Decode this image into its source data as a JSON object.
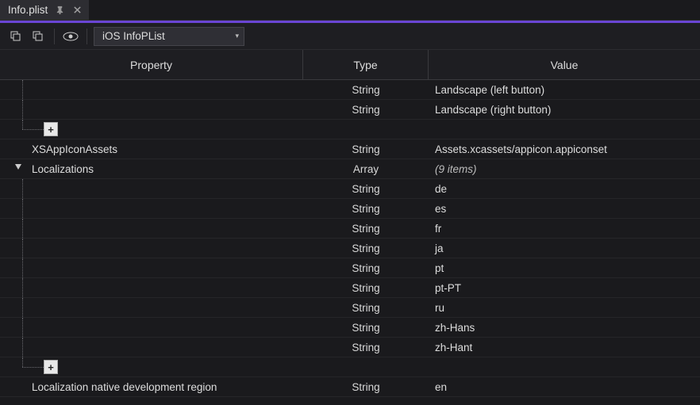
{
  "tab": {
    "title": "Info.plist"
  },
  "toolbar": {
    "dropdown": "iOS InfoPList"
  },
  "columns": {
    "property": "Property",
    "type": "Type",
    "value": "Value"
  },
  "rows": [
    {
      "indent": 1,
      "guide": "through",
      "prop": "",
      "type": "String",
      "value": "Landscape (left button)"
    },
    {
      "indent": 1,
      "guide": "through",
      "prop": "",
      "type": "String",
      "value": "Landscape (right button)"
    },
    {
      "indent": 1,
      "guide": "end-add",
      "prop": "",
      "type": "",
      "value": ""
    },
    {
      "indent": 0,
      "guide": "none",
      "prop": "XSAppIconAssets",
      "type": "String",
      "value": "Assets.xcassets/appicon.appiconset"
    },
    {
      "indent": 0,
      "guide": "expander",
      "prop": "Localizations",
      "type": "Array",
      "value": "(9 items)",
      "italic": true
    },
    {
      "indent": 1,
      "guide": "start",
      "prop": "",
      "type": "String",
      "value": "de"
    },
    {
      "indent": 1,
      "guide": "through",
      "prop": "",
      "type": "String",
      "value": "es"
    },
    {
      "indent": 1,
      "guide": "through",
      "prop": "",
      "type": "String",
      "value": "fr"
    },
    {
      "indent": 1,
      "guide": "through",
      "prop": "",
      "type": "String",
      "value": "ja"
    },
    {
      "indent": 1,
      "guide": "through",
      "prop": "",
      "type": "String",
      "value": "pt"
    },
    {
      "indent": 1,
      "guide": "through",
      "prop": "",
      "type": "String",
      "value": "pt-PT"
    },
    {
      "indent": 1,
      "guide": "through",
      "prop": "",
      "type": "String",
      "value": "ru"
    },
    {
      "indent": 1,
      "guide": "through",
      "prop": "",
      "type": "String",
      "value": "zh-Hans"
    },
    {
      "indent": 1,
      "guide": "through",
      "prop": "",
      "type": "String",
      "value": "zh-Hant"
    },
    {
      "indent": 1,
      "guide": "end-add",
      "prop": "",
      "type": "",
      "value": ""
    },
    {
      "indent": 0,
      "guide": "none",
      "prop": "Localization native development region",
      "type": "String",
      "value": "en"
    }
  ]
}
